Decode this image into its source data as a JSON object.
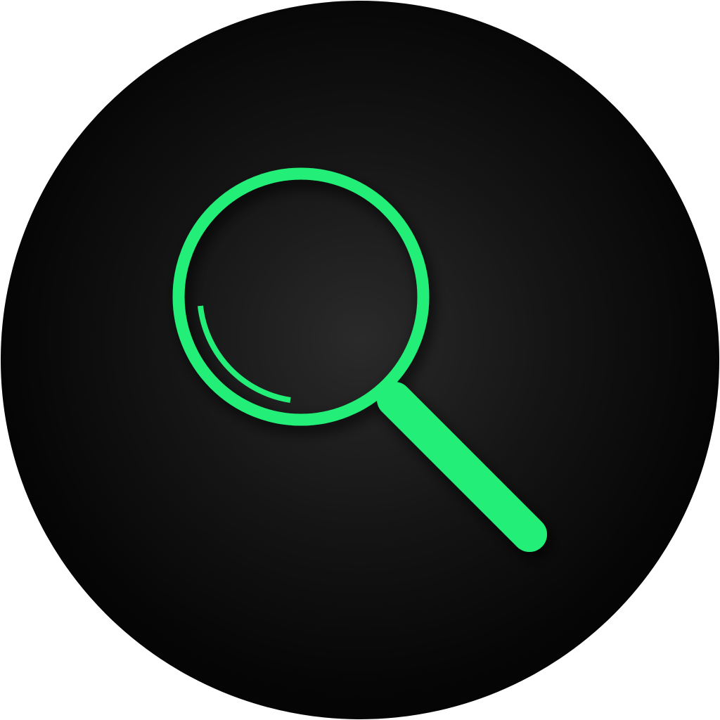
{
  "app_icon": {
    "icon": "search-icon",
    "colors": {
      "accent": "#22EE78",
      "disc_center": "#2A2A2A",
      "disc_mid": "#141414",
      "disc_edge": "#050505",
      "page_background": "#FFFFFF"
    }
  }
}
